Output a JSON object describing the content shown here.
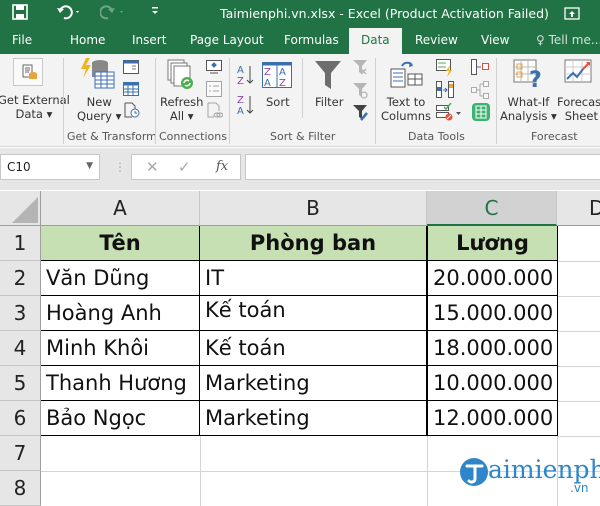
{
  "titlebar": {
    "title": "Taimienphi.vn.xlsx - Excel (Product Activation Failed)",
    "quick_access": {
      "save": "save-icon",
      "undo": "undo-icon",
      "redo": "redo-icon",
      "customize": "customize-icon"
    }
  },
  "tabs": [
    {
      "label": "File"
    },
    {
      "label": "Home"
    },
    {
      "label": "Insert"
    },
    {
      "label": "Page Layout"
    },
    {
      "label": "Formulas"
    },
    {
      "label": "Data",
      "active": true
    },
    {
      "label": "Review"
    },
    {
      "label": "View"
    },
    {
      "label": "Tell me..."
    }
  ],
  "ribbon": {
    "groups": [
      {
        "label": "Get & Transform"
      },
      {
        "label": "Connections"
      },
      {
        "label": "Sort & Filter"
      },
      {
        "label": "Data Tools"
      },
      {
        "label": "Forecast"
      }
    ],
    "buttons": {
      "get_external_1": "Get External",
      "get_external_2": "Data ▾",
      "new_query_1": "New",
      "new_query_2": "Query ▾",
      "refresh_1": "Refresh",
      "refresh_2": "All ▾",
      "sort": "Sort",
      "filter": "Filter",
      "text_cols_1": "Text to",
      "text_cols_2": "Columns",
      "whatif_1": "What-If",
      "whatif_2": "Analysis ▾",
      "forecast_1": "Forecast",
      "forecast_2": "Sheet"
    }
  },
  "formula_bar": {
    "name_box": "C10",
    "cancel": "✕",
    "enter": "✓",
    "fx": "fx",
    "value": ""
  },
  "sheet": {
    "columns": [
      "A",
      "B",
      "C",
      "D"
    ],
    "selected_column": "C",
    "rows": [
      "1",
      "2",
      "3",
      "4",
      "5",
      "6",
      "7",
      "8"
    ],
    "header": [
      "Tên",
      "Phòng ban",
      "Lương"
    ],
    "data": [
      [
        "Văn Dũng",
        "IT",
        "20.000.000"
      ],
      [
        "Hoàng Anh",
        "Kế toán",
        "15.000.000"
      ],
      [
        "Minh Khôi",
        "Kế toán",
        "18.000.000"
      ],
      [
        "Thanh Hương",
        "Marketing",
        "10.000.000"
      ],
      [
        "Bảo Ngọc",
        "Marketing",
        "12.000.000"
      ]
    ]
  },
  "watermark": {
    "brand": "aimienphi",
    "suffix": ".vn"
  },
  "colors": {
    "excel_green": "#217346",
    "header_fill": "#c6e0b4"
  }
}
